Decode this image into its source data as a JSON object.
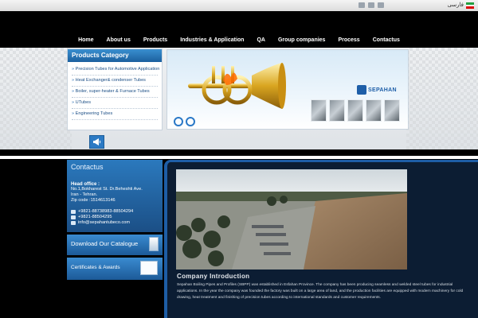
{
  "topbar": {
    "lang_label": "فارسی"
  },
  "nav": {
    "items": [
      "Home",
      "About us",
      "Products",
      "Industries & Application",
      "QA",
      "Group companies",
      "Process",
      "Contactus"
    ]
  },
  "products": {
    "title": "Products Category",
    "items": [
      "Precision Tubes for Automotive Application",
      "Heat Exchanger& condenser Tubes",
      "Boiler, super-heater & Furnace Tubes",
      "UTubes",
      "Engineering Tubes"
    ]
  },
  "banner": {
    "brand": "SEPAHAN"
  },
  "contact": {
    "title": "Contactus",
    "head_office_label": "Head office :",
    "address_1": "No.1,Bokharest St. Dr.Beheshti Ave.",
    "address_2": "Iran - Tehran.",
    "zip": "Zip code :1514613146",
    "phone": "+9821-88738983-88504294",
    "fax": "+9821-88504295",
    "email": "info@sepahantubeco.com"
  },
  "catalogue": {
    "label": "Download Our Catalogue"
  },
  "certs": {
    "label": "Certificates & Awards"
  },
  "main": {
    "title": "Company Introduction",
    "body": "Sepahan Boiling Pipes and Profiles (SBPP) was established in Esfahan Province. The company has been producing seamless and welded steel tubes for industrial applications. In the year the company was founded the factory was built on a large area of land, and the production facilities are equipped with modern machinery for cold drawing, heat treatment and finishing of precision tubes according to international standards and customer requirements."
  },
  "colors": {
    "accent": "#1e5ea6",
    "header_blue": "#2b79bd"
  }
}
